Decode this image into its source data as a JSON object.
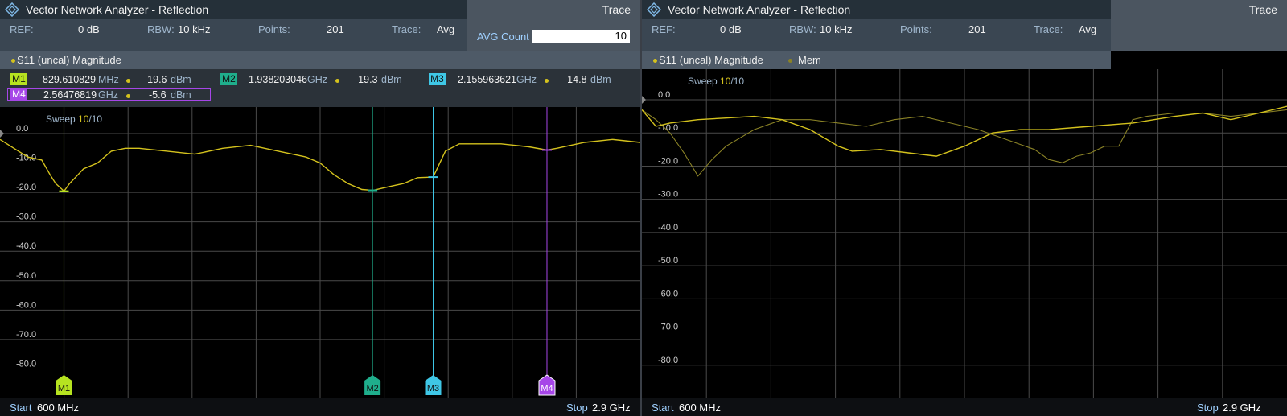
{
  "left": {
    "title": "Vector Network Analyzer - Reflection",
    "trace_tab": "Trace",
    "info": {
      "ref_label": "REF:",
      "ref_value": "0 dB",
      "rbw_label": "RBW:",
      "rbw_value": "10 kHz",
      "points_label": "Points:",
      "points_value": "201",
      "trace_label": "Trace:",
      "trace_value": "Avg"
    },
    "avg_count_label": "AVG Count",
    "avg_count_value": "10",
    "trace_name": "S11 (uncal) Magnitude",
    "sweep_label": "Sweep",
    "sweep_current": "10",
    "sweep_total": "/10",
    "markers": [
      {
        "tag": "M1",
        "freq": "829.610829",
        "unit": "MHz",
        "level": "-19.6",
        "level_unit": "dBm",
        "color": "#b6e320"
      },
      {
        "tag": "M2",
        "freq": "1.938203046",
        "unit": "GHz",
        "level": "-19.3",
        "level_unit": "dBm",
        "color": "#1fae8c"
      },
      {
        "tag": "M3",
        "freq": "2.155963621",
        "unit": "GHz",
        "level": "-14.8",
        "level_unit": "dBm",
        "color": "#3fc7e6"
      },
      {
        "tag": "M4",
        "freq": "2.56476819",
        "unit": "GHz",
        "level": "-5.6",
        "level_unit": "dBm",
        "color": "#a646e8"
      }
    ],
    "start_label": "Start",
    "start_value": "600 MHz",
    "stop_label": "Stop",
    "stop_value": "2.9 GHz"
  },
  "right": {
    "title": "Vector Network Analyzer - Reflection",
    "trace_tab": "Trace",
    "info": {
      "ref_label": "REF:",
      "ref_value": "0 dB",
      "rbw_label": "RBW:",
      "rbw_value": "10 kHz",
      "points_label": "Points:",
      "points_value": "201",
      "trace_label": "Trace:",
      "trace_value": "Avg"
    },
    "trace_name": "S11 (uncal) Magnitude",
    "mem_label": "Mem",
    "sweep_label": "Sweep",
    "sweep_current": "10",
    "sweep_total": "/10",
    "start_label": "Start",
    "start_value": "600 MHz",
    "stop_label": "Stop",
    "stop_value": "2.9 GHz"
  },
  "colors": {
    "trace": "#d4c21d",
    "mem_trace": "#8a8226",
    "grid": "#4a4a4a",
    "accent": "#9fd0ff"
  },
  "chart_data": [
    {
      "type": "line",
      "title": "S11 (uncal) Magnitude",
      "x_unit": "GHz",
      "xlim": [
        0.6,
        2.9
      ],
      "ylim": [
        -90,
        0
      ],
      "yticks": [
        "0.0",
        "-10.0",
        "-20.0",
        "-30.0",
        "-40.0",
        "-50.0",
        "-60.0",
        "-70.0",
        "-80.0"
      ],
      "ytick_values": [
        0,
        -10,
        -20,
        -30,
        -40,
        -50,
        -60,
        -70,
        -80
      ],
      "grid": true,
      "series": [
        {
          "name": "S11 (uncal) Magnitude",
          "x": [
            0.6,
            0.65,
            0.7,
            0.75,
            0.78,
            0.8,
            0.83,
            0.85,
            0.88,
            0.9,
            0.95,
            1.0,
            1.05,
            1.1,
            1.2,
            1.3,
            1.4,
            1.5,
            1.6,
            1.7,
            1.75,
            1.8,
            1.85,
            1.9,
            1.94,
            2.0,
            2.05,
            2.1,
            2.156,
            2.2,
            2.25,
            2.3,
            2.4,
            2.5,
            2.565,
            2.6,
            2.7,
            2.8,
            2.9
          ],
          "y": [
            -2,
            -5,
            -8,
            -9,
            -14,
            -17,
            -19.6,
            -17,
            -14,
            -12,
            -10,
            -6,
            -5,
            -5,
            -6,
            -7,
            -5,
            -4,
            -6,
            -8,
            -10,
            -14,
            -17,
            -19,
            -19.3,
            -18,
            -17,
            -15,
            -14.8,
            -6,
            -3.5,
            -3.5,
            -3.5,
            -4.5,
            -5.6,
            -5,
            -3,
            -2,
            -3
          ]
        }
      ],
      "markers": [
        {
          "name": "M1",
          "x": 0.829610829,
          "y": -19.6
        },
        {
          "name": "M2",
          "x": 1.938203046,
          "y": -19.3
        },
        {
          "name": "M3",
          "x": 2.155963621,
          "y": -14.8
        },
        {
          "name": "M4",
          "x": 2.56476819,
          "y": -5.6
        }
      ]
    },
    {
      "type": "line",
      "title": "S11 (uncal) Magnitude",
      "x_unit": "GHz",
      "xlim": [
        0.6,
        2.9
      ],
      "ylim": [
        -90,
        0
      ],
      "yticks": [
        "0.0",
        "-10.0",
        "-20.0",
        "-30.0",
        "-40.0",
        "-50.0",
        "-60.0",
        "-70.0",
        "-80.0"
      ],
      "ytick_values": [
        0,
        -10,
        -20,
        -30,
        -40,
        -50,
        -60,
        -70,
        -80
      ],
      "grid": true,
      "series": [
        {
          "name": "S11 (uncal) Magnitude",
          "x": [
            0.6,
            0.65,
            0.7,
            0.8,
            0.9,
            1.0,
            1.1,
            1.2,
            1.3,
            1.35,
            1.45,
            1.55,
            1.65,
            1.75,
            1.85,
            1.95,
            2.05,
            2.2,
            2.35,
            2.5,
            2.6,
            2.7,
            2.8,
            2.9
          ],
          "y": [
            -3,
            -8,
            -7,
            -6,
            -5.5,
            -5,
            -6,
            -9,
            -14,
            -15.5,
            -15,
            -16,
            -17,
            -14,
            -10,
            -9,
            -9,
            -8,
            -7,
            -5,
            -4,
            -6,
            -4,
            -2
          ]
        },
        {
          "name": "Mem",
          "x": [
            0.6,
            0.65,
            0.7,
            0.75,
            0.8,
            0.85,
            0.9,
            1.0,
            1.1,
            1.2,
            1.3,
            1.4,
            1.5,
            1.6,
            1.7,
            1.8,
            1.9,
            2.0,
            2.05,
            2.1,
            2.15,
            2.2,
            2.25,
            2.3,
            2.35,
            2.4,
            2.5,
            2.6,
            2.7,
            2.8,
            2.9
          ],
          "y": [
            -3,
            -6,
            -10,
            -16,
            -23,
            -18,
            -14,
            -9,
            -6,
            -6,
            -7,
            -8,
            -6,
            -5,
            -7,
            -9,
            -12,
            -15,
            -18,
            -19,
            -17,
            -16,
            -14,
            -14,
            -6,
            -5,
            -4,
            -4,
            -5,
            -4,
            -3
          ]
        }
      ]
    }
  ]
}
